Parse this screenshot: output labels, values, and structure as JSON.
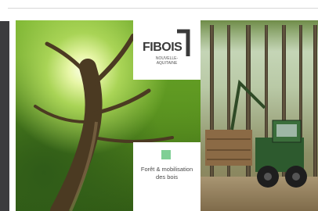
{
  "logo": {
    "brand": "FIBOIS",
    "subtitle": "NOUVELLE-AQUITAINE",
    "accent": "#3a3a3a"
  },
  "caption": {
    "text": "Forêt & mobilisation des bois",
    "icon": "green-square-icon",
    "icon_color": "#7fcf95"
  },
  "colors": {
    "sidebar": "#3c3c3e",
    "background": "#ffffff"
  }
}
